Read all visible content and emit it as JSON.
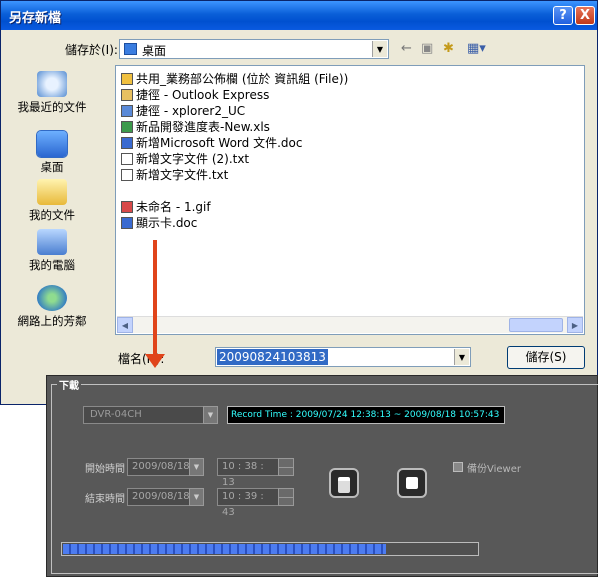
{
  "dialog": {
    "title": "另存新檔",
    "help_btn": "?",
    "close_btn": "X",
    "save_in_label": "儲存於(I):",
    "save_in_value": "桌面",
    "places": [
      "我最近的文件",
      "桌面",
      "我的文件",
      "我的電腦",
      "網路上的芳鄰"
    ],
    "files": [
      "共用_業務部公佈欄 (位於 資訊組 (File))",
      "捷徑 - Outlook Express",
      "捷徑 - xplorer2_UC",
      "新品開發進度表-New.xls",
      "新增Microsoft Word 文件.doc",
      "新增文字文件 (2).txt",
      "新增文字文件.txt",
      "未命名 - 1.gif",
      "顯示卡.doc"
    ],
    "filename_label": "檔名(N):",
    "filename_value": "20090824103813",
    "save_button": "儲存(S)"
  },
  "download": {
    "title": "下載",
    "dvr_select": "DVR-04CH",
    "record_time": "Record Time : 2009/07/24 12:38:13 ~ 2009/08/18 10:57:43",
    "start_label": "開始時間",
    "start_date": "2009/08/18",
    "start_time": "10 : 38 : 13",
    "end_label": "結束時間",
    "end_date": "2009/08/18",
    "end_time": "10 : 39 : 43",
    "backup_viewer_label": "備份Viewer",
    "progress_fraction": 0.78
  }
}
